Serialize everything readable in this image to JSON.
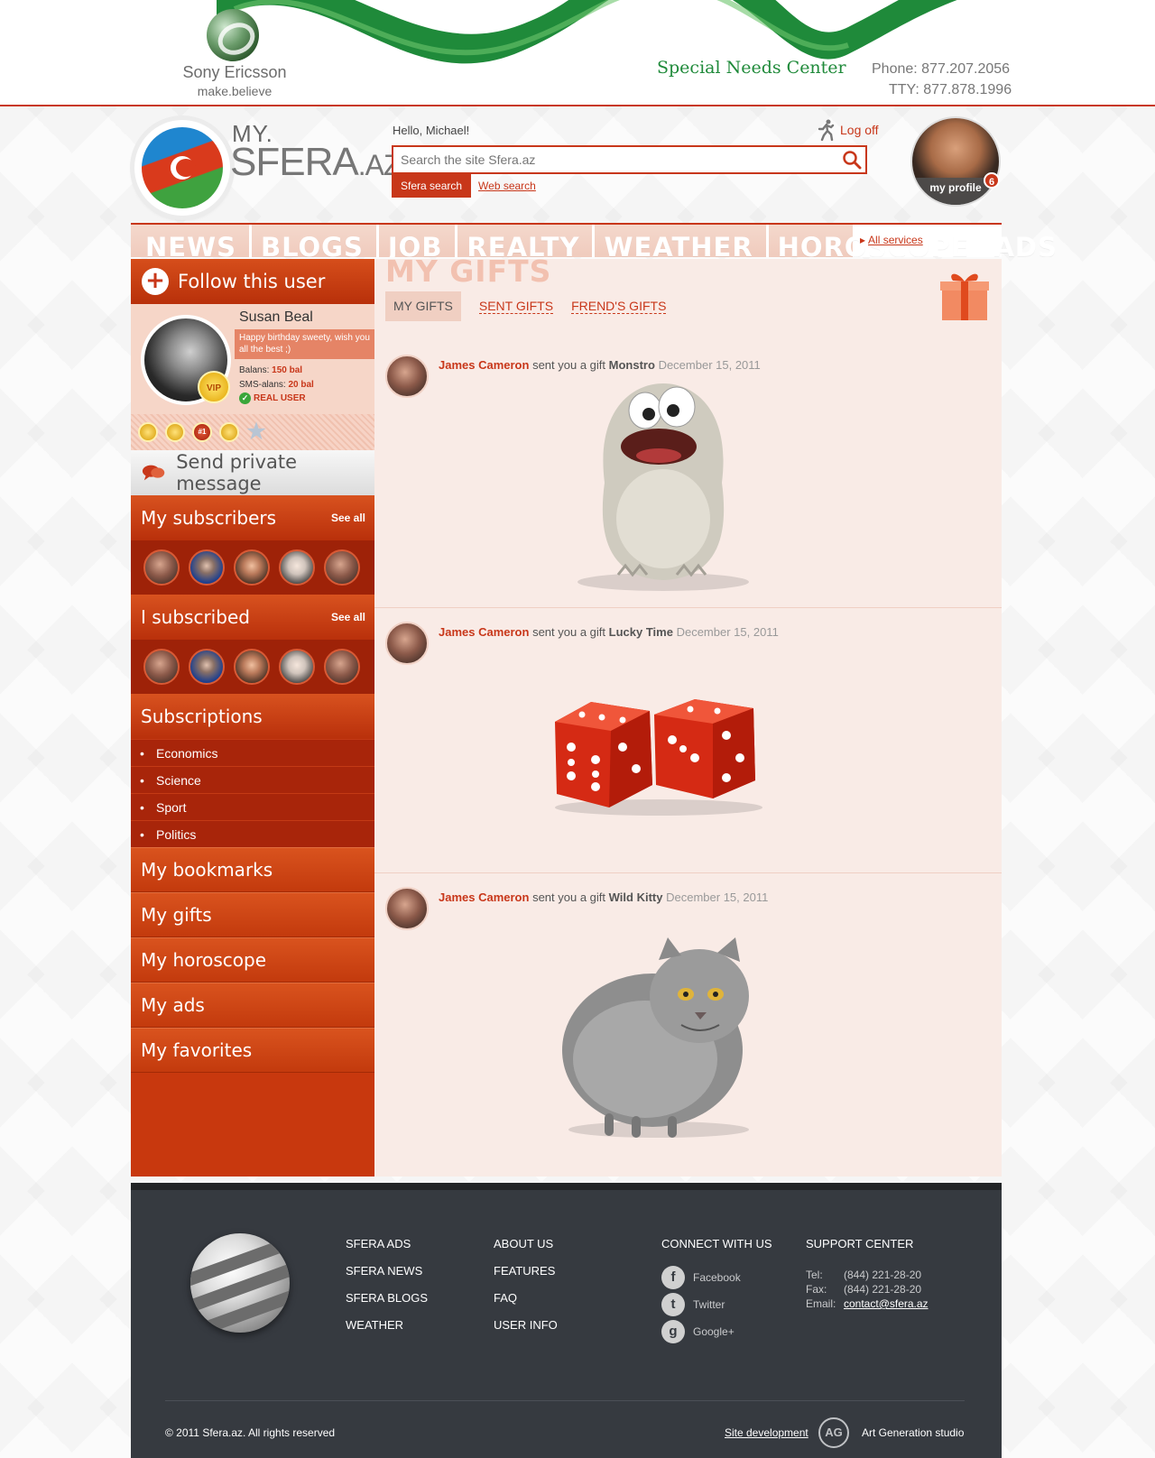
{
  "banner": {
    "brand": "Sony Ericsson",
    "slogan": "make.believe",
    "special_needs": "Special Needs Center",
    "phone": "Phone: 877.207.2056",
    "tty": "TTY: 877.878.1996"
  },
  "logo": {
    "my": "MY.",
    "sfera": "SFERA",
    "az": ".AZ"
  },
  "header": {
    "greeting": "Hello, Michael!",
    "logoff": "Log off",
    "search_placeholder": "Search the site Sfera.az",
    "search_tab_active": "Sfera search",
    "search_tab_web": "Web search",
    "profile_label": "my profile",
    "profile_badge": "6"
  },
  "nav": {
    "items": [
      "NEWS",
      "BLOGS",
      "JOB",
      "REALTY",
      "WEATHER",
      "HOROSCOPE",
      "ADS"
    ],
    "all_services": "All services"
  },
  "sidebar": {
    "follow": "Follow this user",
    "user": {
      "name": "Susan Beal",
      "status": "Happy birthday sweety, wish you all the best ;)",
      "balans_label": "Balans:",
      "balans_value": "150 bal",
      "sms_label": "SMS-alans:",
      "sms_value": "20 bal",
      "real_user": "REAL USER",
      "vip": "VIP"
    },
    "medal_rank": "#1",
    "private_message": "Send private message",
    "subscribers_title": "My subscribers",
    "subscribed_title": "I subscribed",
    "see_all": "See all",
    "subscriptions_title": "Subscriptions",
    "subscriptions": [
      "Economics",
      "Science",
      "Sport",
      "Politics"
    ],
    "links": [
      "My bookmarks",
      "My gifts",
      "My horoscope",
      "My ads",
      "My favorites"
    ]
  },
  "main": {
    "title": "MY GIFTS",
    "tabs": [
      "MY GIFTS",
      "SENT GIFTS",
      "FREND'S GIFTS"
    ],
    "gifts": [
      {
        "sender": "James Cameron",
        "text": "sent you a gift",
        "gift": "Monstro",
        "date": "December 15, 2011"
      },
      {
        "sender": "James Cameron",
        "text": "sent you a gift",
        "gift": "Lucky Time",
        "date": "December 15, 2011"
      },
      {
        "sender": "James Cameron",
        "text": "sent you a gift",
        "gift": "Wild Kitty",
        "date": "December 15, 2011"
      }
    ]
  },
  "footer": {
    "col1": [
      "SFERA ADS",
      "SFERA NEWS",
      "SFERA BLOGS",
      "WEATHER"
    ],
    "col2": [
      "ABOUT US",
      "FEATURES",
      "FAQ",
      "USER INFO"
    ],
    "connect_title": "CONNECT WITH US",
    "social": [
      "Facebook",
      "Twitter",
      "Google+"
    ],
    "support_title": "SUPPORT CENTER",
    "tel_label": "Tel:",
    "tel": "(844) 221-28-20",
    "fax_label": "Fax:",
    "fax": "(844) 221-28-20",
    "email_label": "Email:",
    "email": "contact@sfera.az",
    "copyright": "© 2011 Sfera.az. All rights reserved",
    "site_dev": "Site development",
    "studio": "Art Generation studio"
  }
}
